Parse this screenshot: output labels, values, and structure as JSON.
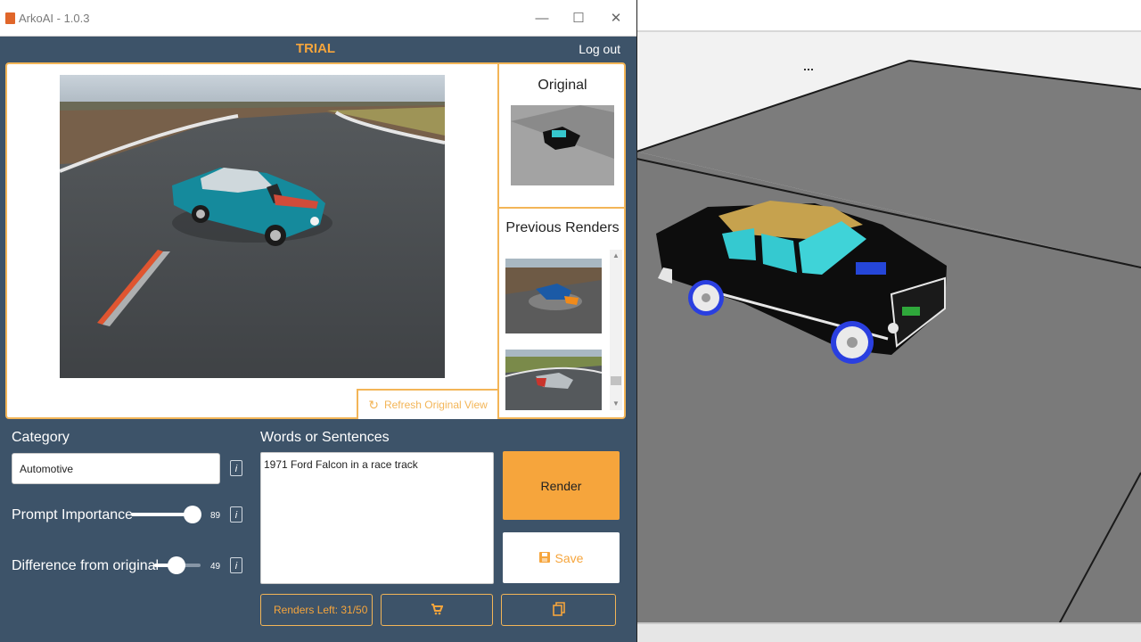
{
  "window": {
    "title": "ArkoAI - 1.0.3",
    "minimize_glyph": "—",
    "maximize_glyph": "☐",
    "close_glyph": "✕"
  },
  "header": {
    "plan": "TRIAL",
    "logout_label": "Log out"
  },
  "preview": {
    "original_label": "Original",
    "previous_renders_label": "Previous Renders",
    "refresh_label": "Refresh Original View",
    "refresh_icon": "refresh-icon"
  },
  "controls": {
    "category_label": "Category",
    "category_value": "Automotive",
    "prompt_importance_label": "Prompt Importance",
    "prompt_importance_value": 89,
    "prompt_importance_display": "89",
    "difference_label": "Difference from original",
    "difference_value": 49,
    "difference_display": "49",
    "info_glyph": "i",
    "words_label": "Words or Sentences",
    "words_value": "1971 Ford Falcon in a race track"
  },
  "actions": {
    "render_label": "Render",
    "save_label": "Save",
    "save_icon": "floppy-icon",
    "renders_left_label": "Renders Left: 31/50",
    "cart_icon": "cart-icon",
    "copy_icon": "copy-icon"
  },
  "colors": {
    "accent": "#f6a53c",
    "panel_bg": "#3d5369",
    "border": "#f3b557"
  }
}
